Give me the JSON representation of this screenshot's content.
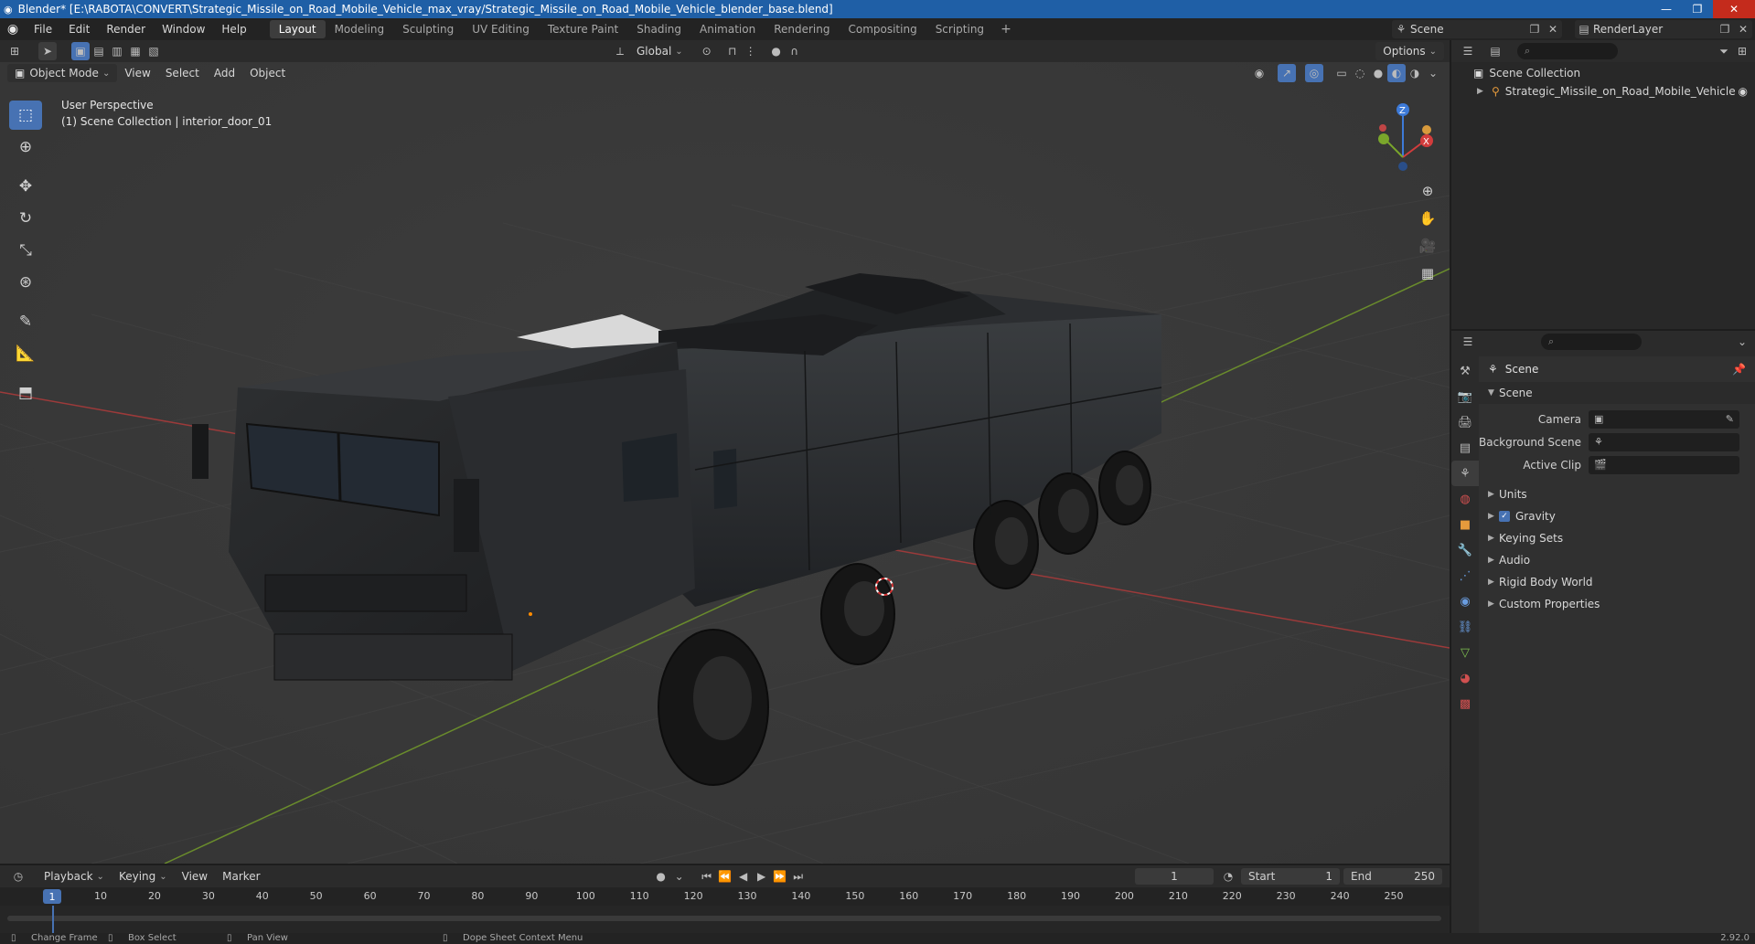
{
  "window": {
    "title": "Blender* [E:\\RABOTA\\CONVERT\\Strategic_Missile_on_Road_Mobile_Vehicle_max_vray/Strategic_Missile_on_Road_Mobile_Vehicle_blender_base.blend]"
  },
  "menu": [
    "File",
    "Edit",
    "Render",
    "Window",
    "Help"
  ],
  "workspaces": [
    "Layout",
    "Modeling",
    "Sculpting",
    "UV Editing",
    "Texture Paint",
    "Shading",
    "Animation",
    "Rendering",
    "Compositing",
    "Scripting"
  ],
  "active_workspace": "Layout",
  "scene_name": "Scene",
  "render_layer": "RenderLayer",
  "viewport": {
    "orientation": "Global",
    "options_label": "Options",
    "mode": "Object Mode",
    "menus": [
      "View",
      "Select",
      "Add",
      "Object"
    ],
    "perspective": "User Perspective",
    "collection_info": "(1) Scene Collection | interior_door_01"
  },
  "outliner": {
    "root": "Scene Collection",
    "items": [
      "Strategic_Missile_on_Road_Mobile_Vehicle"
    ]
  },
  "properties": {
    "title": "Scene",
    "section": "Scene",
    "fields": [
      {
        "label": "Camera",
        "value": ""
      },
      {
        "label": "Background Scene",
        "value": ""
      },
      {
        "label": "Active Clip",
        "value": ""
      }
    ],
    "subsections": [
      "Units",
      "Gravity",
      "Keying Sets",
      "Audio",
      "Rigid Body World",
      "Custom Properties"
    ],
    "gravity_checked": true
  },
  "timeline": {
    "menus": [
      "Playback",
      "Keying",
      "View",
      "Marker"
    ],
    "current_frame": "1",
    "start_label": "Start",
    "start": "1",
    "end_label": "End",
    "end": "250",
    "ticks": [
      "1",
      "10",
      "20",
      "30",
      "40",
      "50",
      "60",
      "70",
      "80",
      "90",
      "100",
      "110",
      "120",
      "130",
      "140",
      "150",
      "160",
      "170",
      "180",
      "190",
      "200",
      "210",
      "220",
      "230",
      "240",
      "250"
    ]
  },
  "statusbar": {
    "hints": [
      "Change Frame",
      "Box Select",
      "Pan View",
      "Dope Sheet Context Menu"
    ],
    "version": "2.92.0"
  }
}
